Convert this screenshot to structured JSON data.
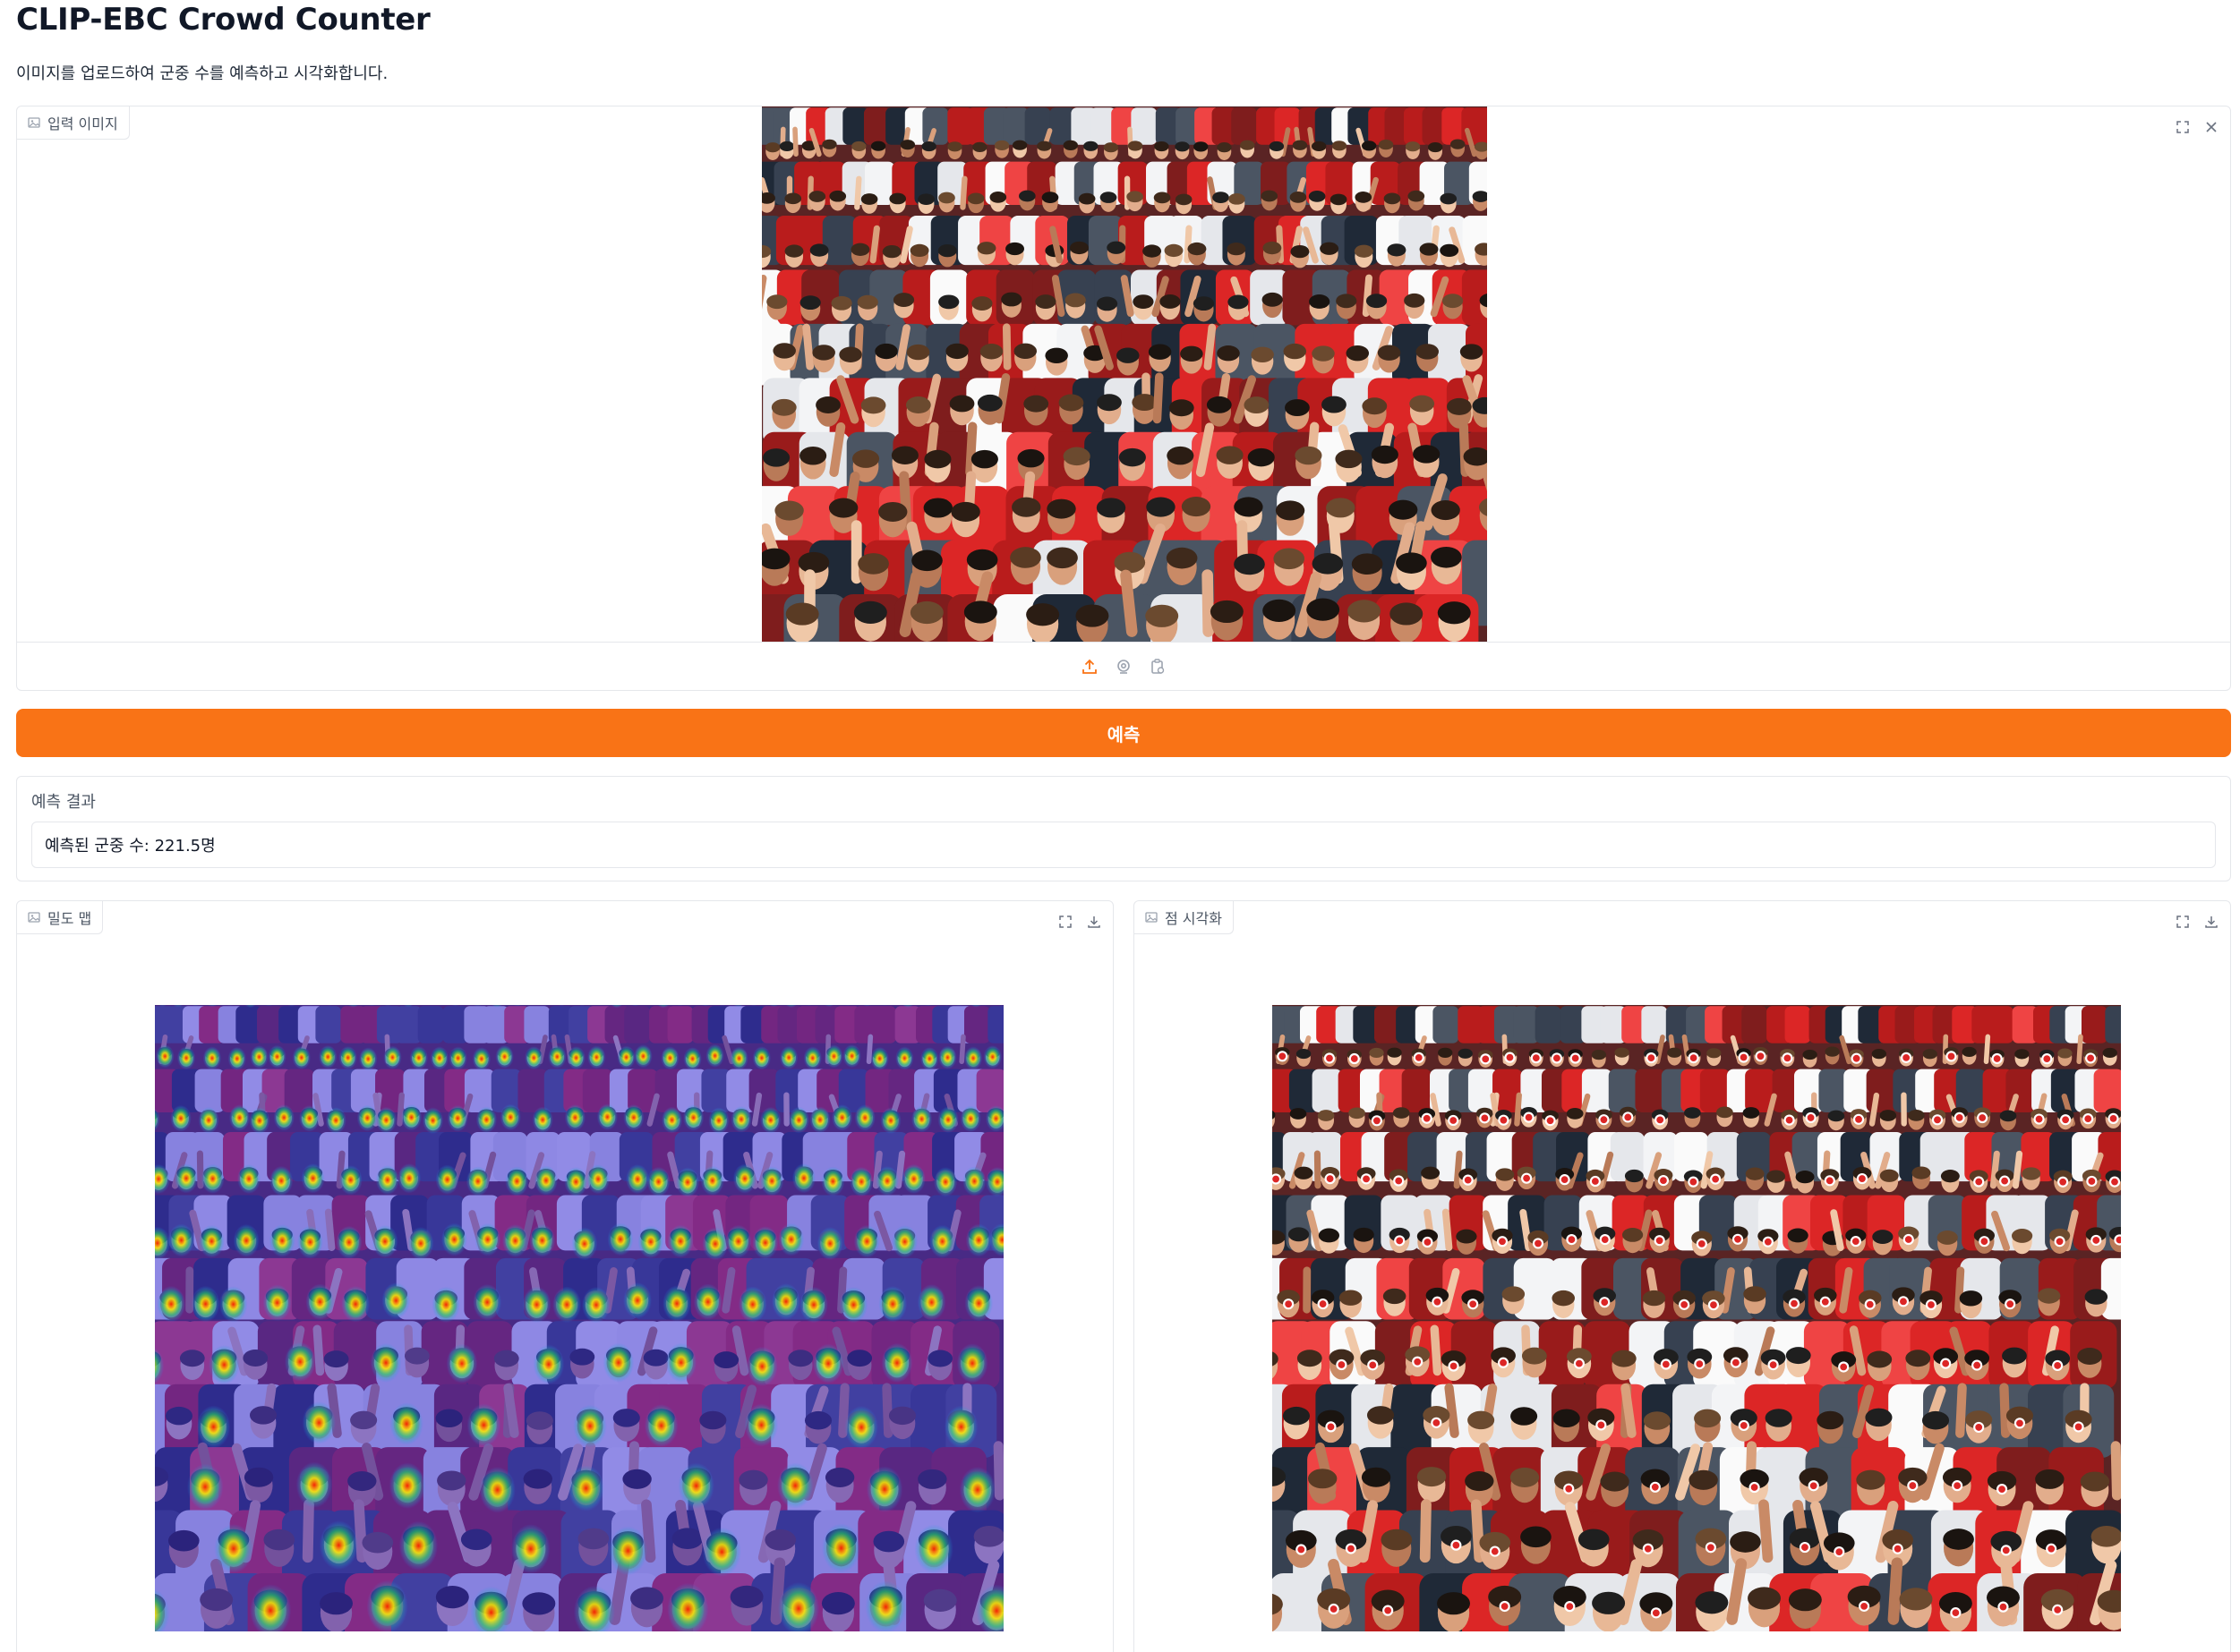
{
  "app": {
    "title": "CLIP-EBC Crowd Counter",
    "description": "이미지를 업로드하여 군중 수를 예측하고 시각화합니다."
  },
  "input_image": {
    "label": "입력 이미지",
    "icons": [
      "image-icon",
      "fullscreen-icon",
      "close-icon",
      "upload-icon",
      "webcam-icon",
      "clipboard-icon"
    ]
  },
  "predict_button": {
    "label": "예측"
  },
  "result": {
    "label": "예측 결과",
    "value": "예측된 군중 수: 221.5명"
  },
  "density_map": {
    "label": "밀도 맵",
    "icons": [
      "image-icon",
      "fullscreen-icon",
      "download-icon"
    ]
  },
  "point_visualization": {
    "label": "점 시각화",
    "icons": [
      "image-icon",
      "fullscreen-icon",
      "download-icon"
    ]
  },
  "colors": {
    "accent": "#f97316",
    "border": "#e5e7eb",
    "point_marker": "#dc2626"
  }
}
